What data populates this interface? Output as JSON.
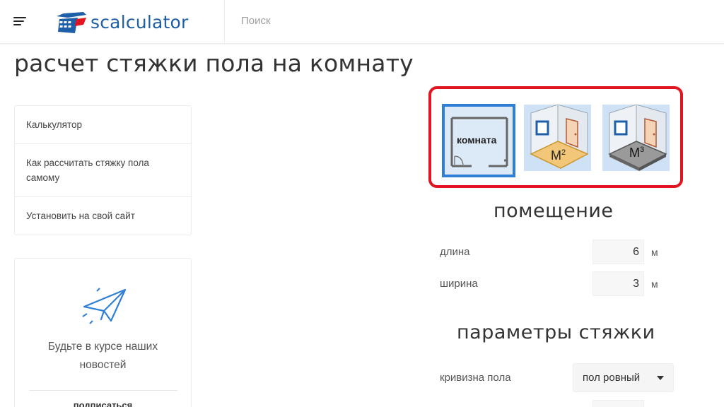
{
  "header": {
    "logo_text": "scalculator",
    "search_placeholder": "Поиск"
  },
  "page": {
    "title": "расчет стяжки пола на комнату"
  },
  "sidebar": {
    "items": [
      {
        "label": "Калькулятор"
      },
      {
        "label": "Как рассчитать стяжку пола самому"
      },
      {
        "label": "Установить на свой сайт"
      }
    ]
  },
  "subscribe": {
    "text": "Будьте в курсе наших новостей",
    "more": "подписаться"
  },
  "mode_selector": {
    "tiles": [
      {
        "label": "комната",
        "selected": true
      },
      {
        "label": "М",
        "sup": "2",
        "selected": false
      },
      {
        "label": "М",
        "sup": "3",
        "selected": false
      }
    ],
    "highlight_color": "#e0151f",
    "selected_color": "#2f7fd6"
  },
  "room": {
    "title": "помещение",
    "length_label": "длина",
    "length_value": "6",
    "length_unit": "м",
    "width_label": "ширина",
    "width_value": "3",
    "width_unit": "м"
  },
  "screed": {
    "title": "параметры стяжки",
    "curvature_label": "кривизна пола",
    "curvature_value": "пол ровный"
  },
  "colors": {
    "brand": "#1f5fa8",
    "accent_red": "#e0151f"
  }
}
